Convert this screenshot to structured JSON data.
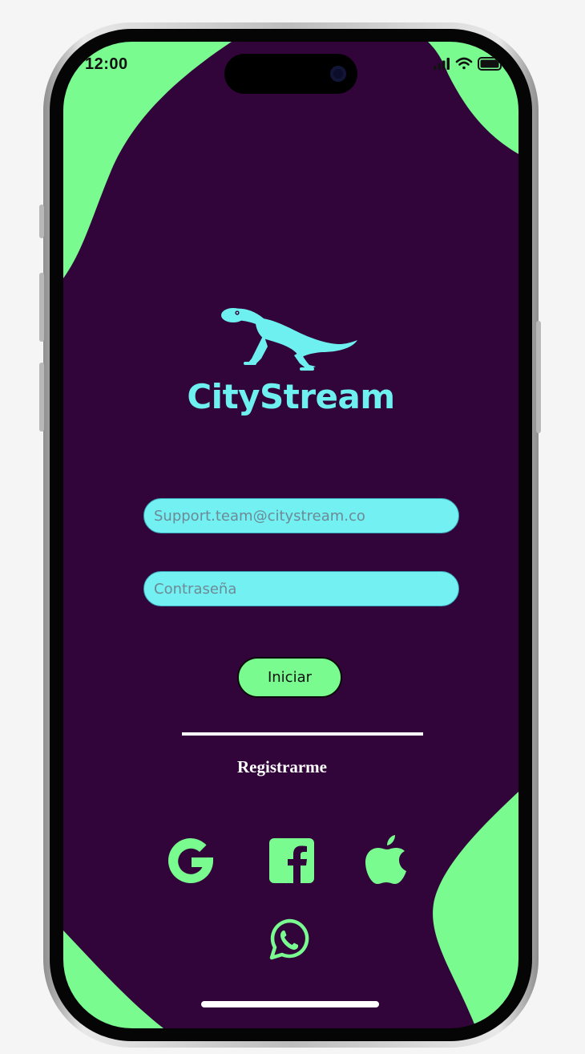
{
  "status_bar": {
    "time": "12:00"
  },
  "brand": {
    "name": "CityStream",
    "logo_icon": "lizard-icon"
  },
  "login_form": {
    "email_placeholder": "Support.team@citystream.co",
    "password_placeholder": "Contraseña",
    "submit_label": "Iniciar"
  },
  "register": {
    "label": "Registrarme"
  },
  "social_login": [
    {
      "icon": "google-icon"
    },
    {
      "icon": "facebook-icon"
    },
    {
      "icon": "apple-icon"
    },
    {
      "icon": "whatsapp-icon"
    }
  ],
  "colors": {
    "background": "#32053a",
    "accent_green": "#79fb8f",
    "accent_cyan": "#72f0f2",
    "brand_text": "#6ef0f0"
  }
}
